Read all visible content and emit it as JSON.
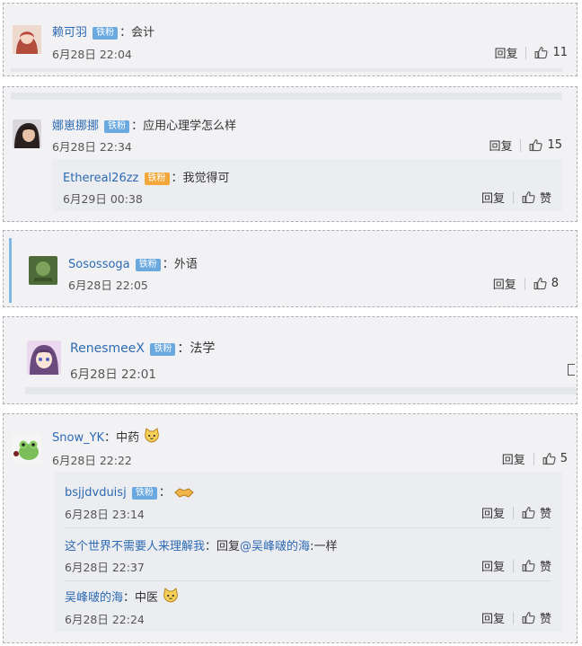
{
  "comments": [
    {
      "user": "赖可羽",
      "badge": "铁粉",
      "text": "会计",
      "time": "6月28日 22:04",
      "reply": "回复",
      "likes": "11"
    },
    {
      "user": "娜崽挪挪",
      "badge": "铁粉",
      "text": "应用心理学怎么样",
      "time": "6月28日 22:34",
      "reply": "回复",
      "likes": "15",
      "subs": [
        {
          "user": "Ethereal26zz",
          "badge": "铁粉",
          "text": "我觉得可",
          "time": "6月29日 00:38",
          "reply": "回复",
          "likes": "赞"
        }
      ]
    },
    {
      "user": "Sosossoga",
      "badge": "铁粉",
      "text": "外语",
      "time": "6月28日 22:05",
      "reply": "回复",
      "likes": "8"
    },
    {
      "user": "RenesmeeX",
      "badge": "铁粉",
      "text": "法学",
      "time": "6月28日 22:01"
    },
    {
      "user": "Snow_YK",
      "text": "中药",
      "time": "6月28日 22:22",
      "reply": "回复",
      "likes": "5",
      "subs": [
        {
          "user": "bsjjdvduisj",
          "badge": "铁粉",
          "text": "",
          "time": "6月28日 23:14",
          "reply": "回复",
          "likes": "赞"
        },
        {
          "user": "这个世界不需要人来理解我",
          "prefix": "回复",
          "mention": "@吴峰啵的海",
          "text": ":一样",
          "time": "6月28日 22:37",
          "reply": "回复",
          "likes": "赞"
        },
        {
          "user": "吴峰啵的海",
          "text": "中医",
          "time": "6月28日 22:24",
          "reply": "回复",
          "likes": "赞"
        }
      ]
    }
  ],
  "colors": {
    "link": "#2d6ab3",
    "badge": "#6aa8e0",
    "card_bg": "#f2f2f5"
  }
}
